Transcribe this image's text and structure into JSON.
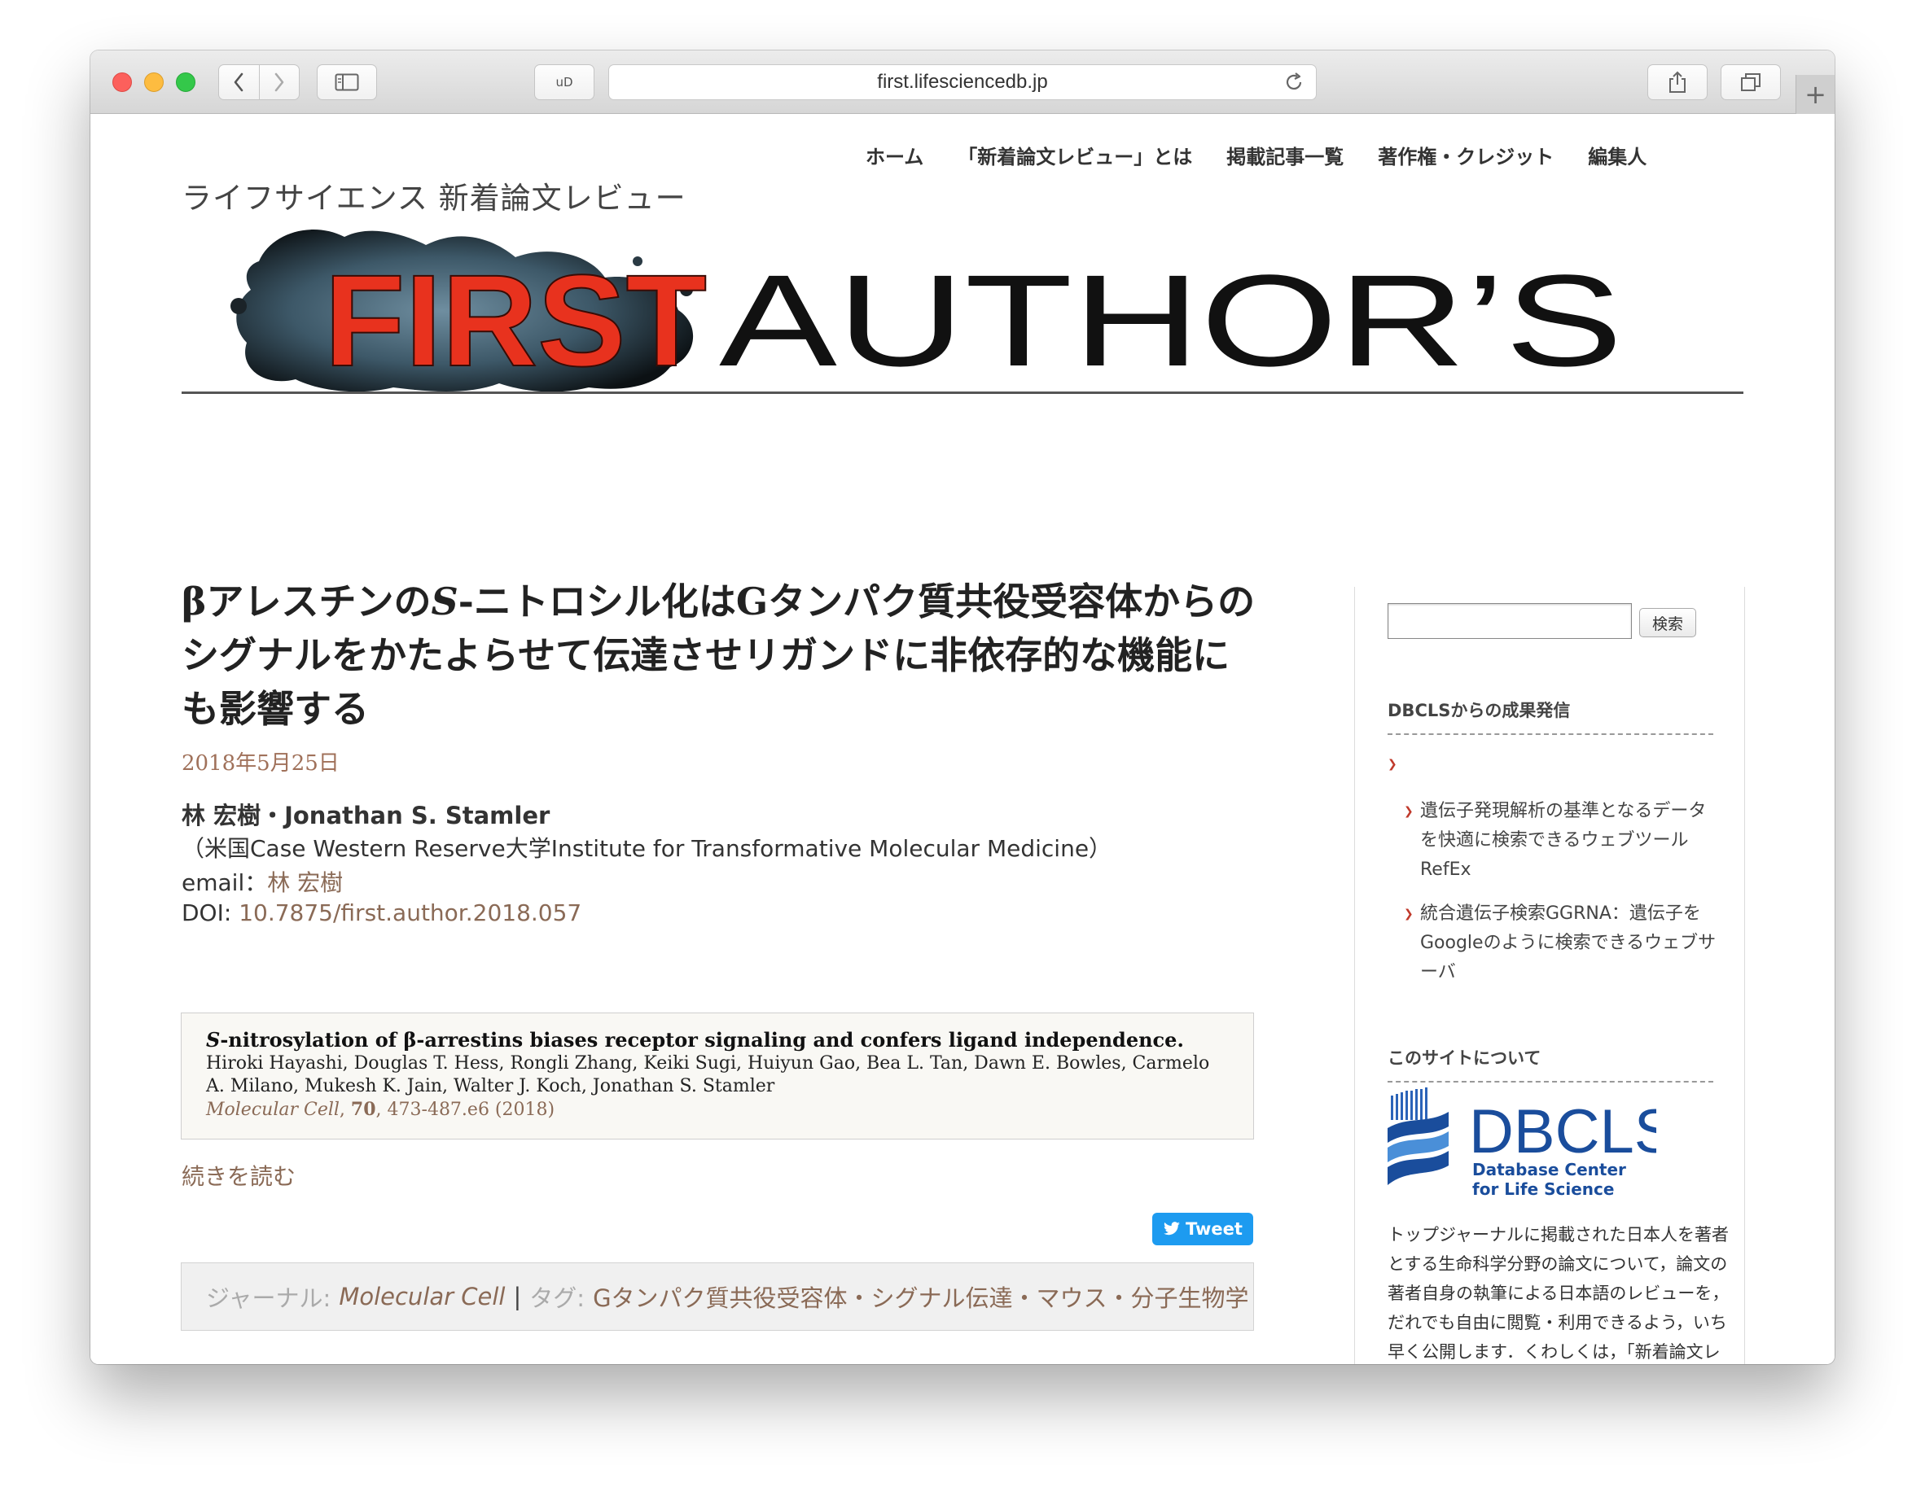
{
  "browser": {
    "url": "first.lifesciencedb.jp",
    "ub_label": "uD",
    "new_tab_symbol": "+"
  },
  "header": {
    "site_title": "ライフサイエンス 新着論文レビュー",
    "nav": [
      {
        "label": "ホーム"
      },
      {
        "label": "「新着論文レビュー」とは"
      },
      {
        "label": "掲載記事一覧"
      },
      {
        "label": "著作権・クレジット"
      },
      {
        "label": "編集人"
      }
    ],
    "banner": {
      "first": "FIRST",
      "rest": "AUTHOR’S"
    }
  },
  "post": {
    "title_part1": "βアレスチンの",
    "title_italic": "S",
    "title_part2": "-ニトロシル化はGタンパク質共役受容体からのシグナルをかたよらせて伝達させリガンドに非依存的な機能にも影響する",
    "date": "2018年5月25日",
    "authors": "林 宏樹・Jonathan S. Stamler",
    "affiliation": "（米国Case Western Reserve大学Institute for Transformative Molecular Medicine）",
    "email_label": "email：",
    "email_name": "林 宏樹",
    "doi_label": "DOI: ",
    "doi_value": "10.7875/first.author.2018.057",
    "citation": {
      "title_italic": "S",
      "title_rest": "-nitrosylation of β-arrestins biases receptor signaling and confers ligand independence.",
      "authors": "Hiroki Hayashi, Douglas T. Hess, Rongli Zhang, Keiki Sugi, Huiyun Gao, Bea L. Tan, Dawn E. Bowles, Carmelo A. Milano, Mukesh K. Jain, Walter J. Koch, Jonathan S. Stamler",
      "journal": "Molecular Cell",
      "volume": "70",
      "pages": ", 473-487.e6 (2018)"
    },
    "read_more": "続きを読む",
    "tweet": "Tweet",
    "journal_label": "ジャーナル:",
    "journal_value": "Molecular Cell",
    "separator": "|",
    "tag_label": "タグ:",
    "tags_value": "Gタンパク質共役受容体・シグナル伝達・マウス・分子生物学"
  },
  "sidebar": {
    "search_button": "検索",
    "search_value": "",
    "widget1_title": "DBCLSからの成果発信",
    "items": [
      {
        "label": "遺伝子発現解析の基準となるデータを快適に検索できるウェブツール RefEx"
      },
      {
        "label": "統合遺伝子検索GGRNA：遺伝子をGoogleのように検索できるウェブサーバ"
      }
    ],
    "widget2_title": "このサイトについて",
    "logo_big": "DBCLS",
    "logo_line1": "Database Center",
    "logo_line2": "for Life Science",
    "about_text": "トップジャーナルに掲載された日本人を著者とする生命科学分野の論文について，論文の著者自身の執筆による日本語のレビューを，だれでも自由に閲覧・利用できるよう，いち早く公開します．くわしくは，「新着論文レビュー」とはをご覧ください．"
  },
  "colors": {
    "link": "#8a6a56",
    "first_red": "#e8321e",
    "tweet_blue": "#1d9bf0",
    "dbcls_blue": "#1a4d9c"
  }
}
